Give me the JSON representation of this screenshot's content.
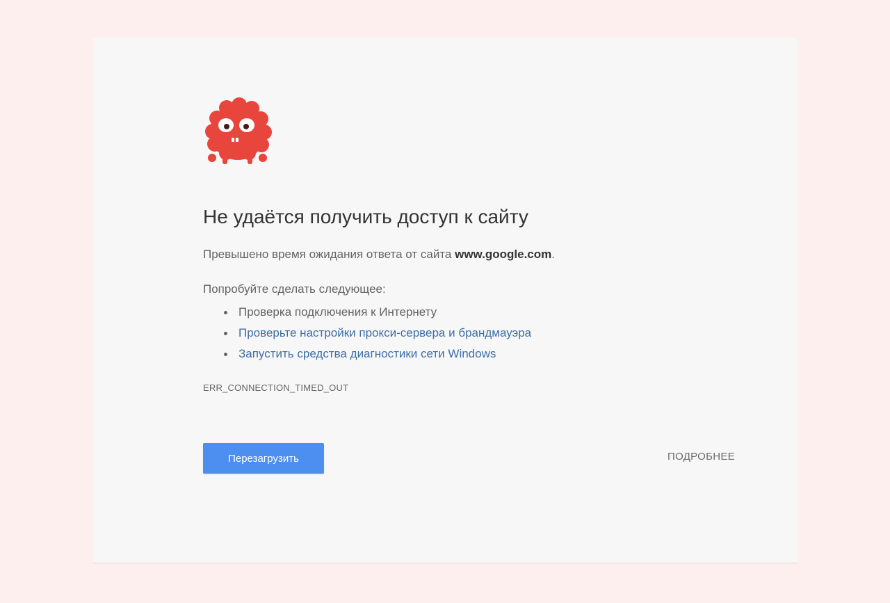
{
  "error_page": {
    "mascot_icon": "sad-red-dinosaur-face",
    "title": "Не удаётся получить доступ к сайту",
    "description_prefix": "Превышено время ожидания ответа от сайта ",
    "description_host": "www.google.com",
    "description_suffix": ".",
    "suggestions_heading": "Попробуйте сделать следующее:",
    "suggestions": [
      {
        "label": "Проверка подключения к Интернету",
        "link": false
      },
      {
        "label": "Проверьте настройки прокси-сервера и брандмауэра",
        "link": true
      },
      {
        "label": "Запустить средства диагностики сети Windows",
        "link": true
      }
    ],
    "error_code": "ERR_CONNECTION_TIMED_OUT",
    "reload_label": "Перезагрузить",
    "details_label": "ПОДРОБНЕЕ"
  },
  "colors": {
    "page_background": "#fdefee",
    "panel_background": "#f7f7f7",
    "mascot_red": "#e8453c",
    "button_blue": "#4c8ff0",
    "link_blue": "#3b6ea8"
  }
}
